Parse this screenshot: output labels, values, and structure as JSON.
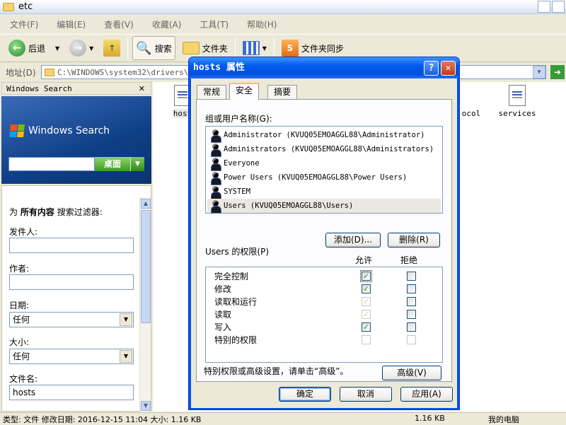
{
  "window": {
    "title": "etc"
  },
  "menu": [
    "文件(F)",
    "编辑(E)",
    "查看(V)",
    "收藏(A)",
    "工具(T)",
    "帮助(H)"
  ],
  "toolbar": {
    "back": "后退",
    "search": "搜索",
    "folders": "文件夹",
    "sync": "文件夹同步"
  },
  "address": {
    "label": "地址(D)",
    "path": "C:\\WINDOWS\\system32\\drivers\\etc"
  },
  "left_panel": {
    "header": "Windows Search",
    "brand": "Windows Search",
    "search_button": "桌面",
    "filter_prefix": "为",
    "filter_scope": "所有内容",
    "filter_suffix": "搜索过滤器:",
    "sender_label": "发件人:",
    "author_label": "作者:",
    "date_label": "日期:",
    "date_value": "任何",
    "size_label": "大小:",
    "size_value": "任何",
    "filename_label": "文件名:",
    "filename_value": "hosts"
  },
  "files": [
    {
      "name": "host"
    },
    {
      "name": "ocol"
    },
    {
      "name": "services"
    }
  ],
  "dialog": {
    "title": "hosts 属性",
    "tabs": [
      "常规",
      "安全",
      "摘要"
    ],
    "users_label": "组或用户名称(G):",
    "users": [
      "Administrator (KVUQ05EMOAGGL88\\Administrator)",
      "Administrators (KVUQ05EMOAGGL88\\Administrators)",
      "Everyone",
      "Power Users (KVUQ05EMOAGGL88\\Power Users)",
      "SYSTEM",
      "Users (KVUQ05EMOAGGL88\\Users)"
    ],
    "add_button": "添加(D)...",
    "remove_button": "删除(R)",
    "perm_label": "Users 的权限(P)",
    "allow_header": "允许",
    "deny_header": "拒绝",
    "permissions": [
      {
        "name": "完全控制",
        "allow": true,
        "allow_disabled": false,
        "deny": false
      },
      {
        "name": "修改",
        "allow": true,
        "allow_disabled": false,
        "deny": false
      },
      {
        "name": "读取和运行",
        "allow": true,
        "allow_disabled": true,
        "deny": false
      },
      {
        "name": "读取",
        "allow": true,
        "allow_disabled": true,
        "deny": false
      },
      {
        "name": "写入",
        "allow": true,
        "allow_disabled": false,
        "deny": false
      },
      {
        "name": "特别的权限",
        "allow": false,
        "allow_disabled": true,
        "deny": false
      }
    ],
    "advanced_text": "特别权限或高级设置，请单击“高级”。",
    "advanced_button": "高级(V)",
    "ok_button": "确定",
    "cancel_button": "取消",
    "apply_button": "应用(A)"
  },
  "status": {
    "info": "类型: 文件 修改日期: 2016-12-15 11:04 大小: 1.16 KB",
    "size": "1.16 KB",
    "location": "我的电脑"
  },
  "colors": {
    "dialog_title": "#0058ee",
    "accent_green": "#3e9a25",
    "check_green": "#21a121"
  }
}
